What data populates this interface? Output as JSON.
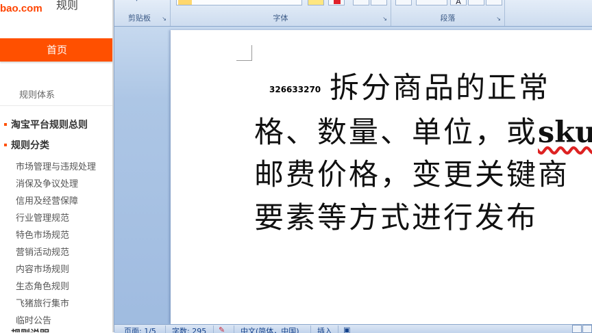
{
  "left_panel": {
    "logo": "bao.com",
    "rules_title": "规则",
    "nav_home": "首页",
    "rule_system": "规则体系",
    "general_rules": "淘宝平台规则总则",
    "category_header": "规则分类",
    "categories": [
      "市场管理与违规处理",
      "消保及争议处理",
      "信用及经营保障",
      "行业管理规范",
      "特色市场规范",
      "营销活动规范",
      "内容市场规则",
      "生态角色规则",
      "飞猪旅行集市",
      "临时公告"
    ],
    "cut_item": "规则说明"
  },
  "ribbon": {
    "clipboard": "剪贴板",
    "font": "字体",
    "paragraph": "段落"
  },
  "document": {
    "code": "326633270",
    "lines": [
      "拆分商品的正常",
      "格、数量、单位，或",
      "邮费价格，变更关键商",
      "要素等方式进行发布"
    ],
    "bold_tail": "sku"
  },
  "status_bar": {
    "page": "页面: 1/5",
    "words": "字数: 295",
    "language": "中文(简体，中国)",
    "mode": "插入"
  },
  "colors": {
    "taobao_orange": "#ff5000",
    "ribbon_text": "#3b5a86",
    "word_blue": "#adc6e5"
  }
}
